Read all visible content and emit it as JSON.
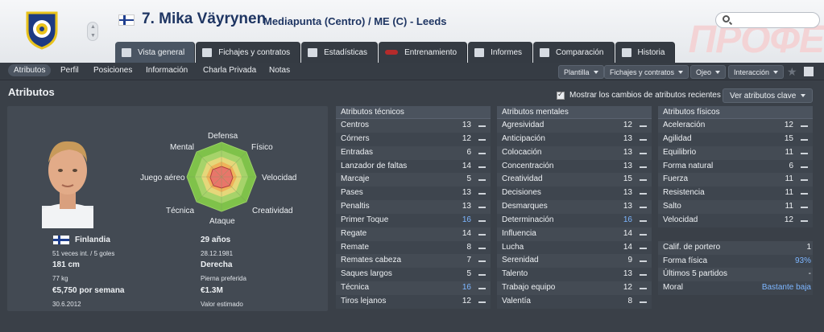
{
  "header": {
    "player_name": "7. Mika Väyrynen",
    "player_sub": "Mediapunta (Centro) / ME (C) - Leeds",
    "watermark": "ПРОФЕ",
    "tabs": [
      {
        "label": "Vista general",
        "icon": "profile-card-icon"
      },
      {
        "label": "Fichajes y contratos",
        "icon": "document-icon"
      },
      {
        "label": "Estadísticas",
        "icon": "chart-icon"
      },
      {
        "label": "Entrenamiento",
        "icon": "training-icon"
      },
      {
        "label": "Informes",
        "icon": "report-icon"
      },
      {
        "label": "Comparación",
        "icon": "compare-icon"
      },
      {
        "label": "Historia",
        "icon": "history-icon"
      }
    ]
  },
  "subnav": {
    "items": [
      "Atributos",
      "Perfil",
      "Posiciones",
      "Información",
      "Charla Privada",
      "Notas"
    ],
    "dropdowns": [
      "Plantilla",
      "Fichajes y contratos",
      "Ojeo",
      "Interacción"
    ]
  },
  "section": {
    "title": "Atributos",
    "checkbox_label": "Mostrar los cambios de atributos recientes",
    "key_button": "Ver atributos clave"
  },
  "polar": {
    "labels": {
      "top": "Defensa",
      "top_left": "Mental",
      "top_right": "Físico",
      "left": "Juego aéreo",
      "right": "Velocidad",
      "bottom_left": "Técnica",
      "bottom_right": "Creatividad",
      "bottom": "Ataque"
    }
  },
  "info": {
    "nationality": "Finlandia",
    "caps": "51 veces int. / 5 goles",
    "height": "181 cm",
    "weight": "77 kg",
    "wage": "€5,750 por semana",
    "contract_end": "30.6.2012",
    "age": "29 años",
    "dob": "28.12.1981",
    "foot": "Derecha",
    "foot_label": "Pierna preferida",
    "value": "€1.3M",
    "value_label": "Valor estimado"
  },
  "technical": {
    "header": "Atributos técnicos",
    "rows": [
      {
        "name": "Centros",
        "value": "13",
        "blue": false
      },
      {
        "name": "Córners",
        "value": "12",
        "blue": false
      },
      {
        "name": "Entradas",
        "value": "6",
        "blue": false
      },
      {
        "name": "Lanzador de faltas",
        "value": "14",
        "blue": false
      },
      {
        "name": "Marcaje",
        "value": "5",
        "blue": false
      },
      {
        "name": "Pases",
        "value": "13",
        "blue": false
      },
      {
        "name": "Penaltis",
        "value": "13",
        "blue": false
      },
      {
        "name": "Primer Toque",
        "value": "16",
        "blue": true
      },
      {
        "name": "Regate",
        "value": "14",
        "blue": false
      },
      {
        "name": "Remate",
        "value": "8",
        "blue": false
      },
      {
        "name": "Remates cabeza",
        "value": "7",
        "blue": false
      },
      {
        "name": "Saques largos",
        "value": "5",
        "blue": false
      },
      {
        "name": "Técnica",
        "value": "16",
        "blue": true
      },
      {
        "name": "Tiros lejanos",
        "value": "12",
        "blue": false
      }
    ]
  },
  "mental": {
    "header": "Atributos mentales",
    "rows": [
      {
        "name": "Agresividad",
        "value": "12",
        "blue": false
      },
      {
        "name": "Anticipación",
        "value": "13",
        "blue": false
      },
      {
        "name": "Colocación",
        "value": "13",
        "blue": false
      },
      {
        "name": "Concentración",
        "value": "13",
        "blue": false
      },
      {
        "name": "Creatividad",
        "value": "15",
        "blue": false
      },
      {
        "name": "Decisiones",
        "value": "13",
        "blue": false
      },
      {
        "name": "Desmarques",
        "value": "13",
        "blue": false
      },
      {
        "name": "Determinación",
        "value": "16",
        "blue": true
      },
      {
        "name": "Influencia",
        "value": "14",
        "blue": false
      },
      {
        "name": "Lucha",
        "value": "14",
        "blue": false
      },
      {
        "name": "Serenidad",
        "value": "9",
        "blue": false
      },
      {
        "name": "Talento",
        "value": "13",
        "blue": false
      },
      {
        "name": "Trabajo equipo",
        "value": "12",
        "blue": false
      },
      {
        "name": "Valentía",
        "value": "8",
        "blue": false
      }
    ]
  },
  "physical": {
    "header": "Atributos físicos",
    "rows": [
      {
        "name": "Aceleración",
        "value": "12",
        "blue": false
      },
      {
        "name": "Agilidad",
        "value": "15",
        "blue": false
      },
      {
        "name": "Equilibrio",
        "value": "11",
        "blue": false
      },
      {
        "name": "Forma natural",
        "value": "6",
        "blue": false
      },
      {
        "name": "Fuerza",
        "value": "11",
        "blue": false
      },
      {
        "name": "Resistencia",
        "value": "11",
        "blue": false
      },
      {
        "name": "Salto",
        "value": "11",
        "blue": false
      },
      {
        "name": "Velocidad",
        "value": "12",
        "blue": false
      }
    ],
    "extras": [
      {
        "name": "Calif. de portero",
        "value": "1",
        "blue": false
      },
      {
        "name": "Forma física",
        "value": "93%",
        "blue": true
      },
      {
        "name": "Últimos 5 partidos",
        "value": "-",
        "blue": false
      },
      {
        "name": "Moral",
        "value": "Bastante baja",
        "blue": true
      }
    ]
  },
  "colors": {
    "name": "#1e3562",
    "bg": "#3a4048",
    "highlight": "#7db6ff"
  }
}
